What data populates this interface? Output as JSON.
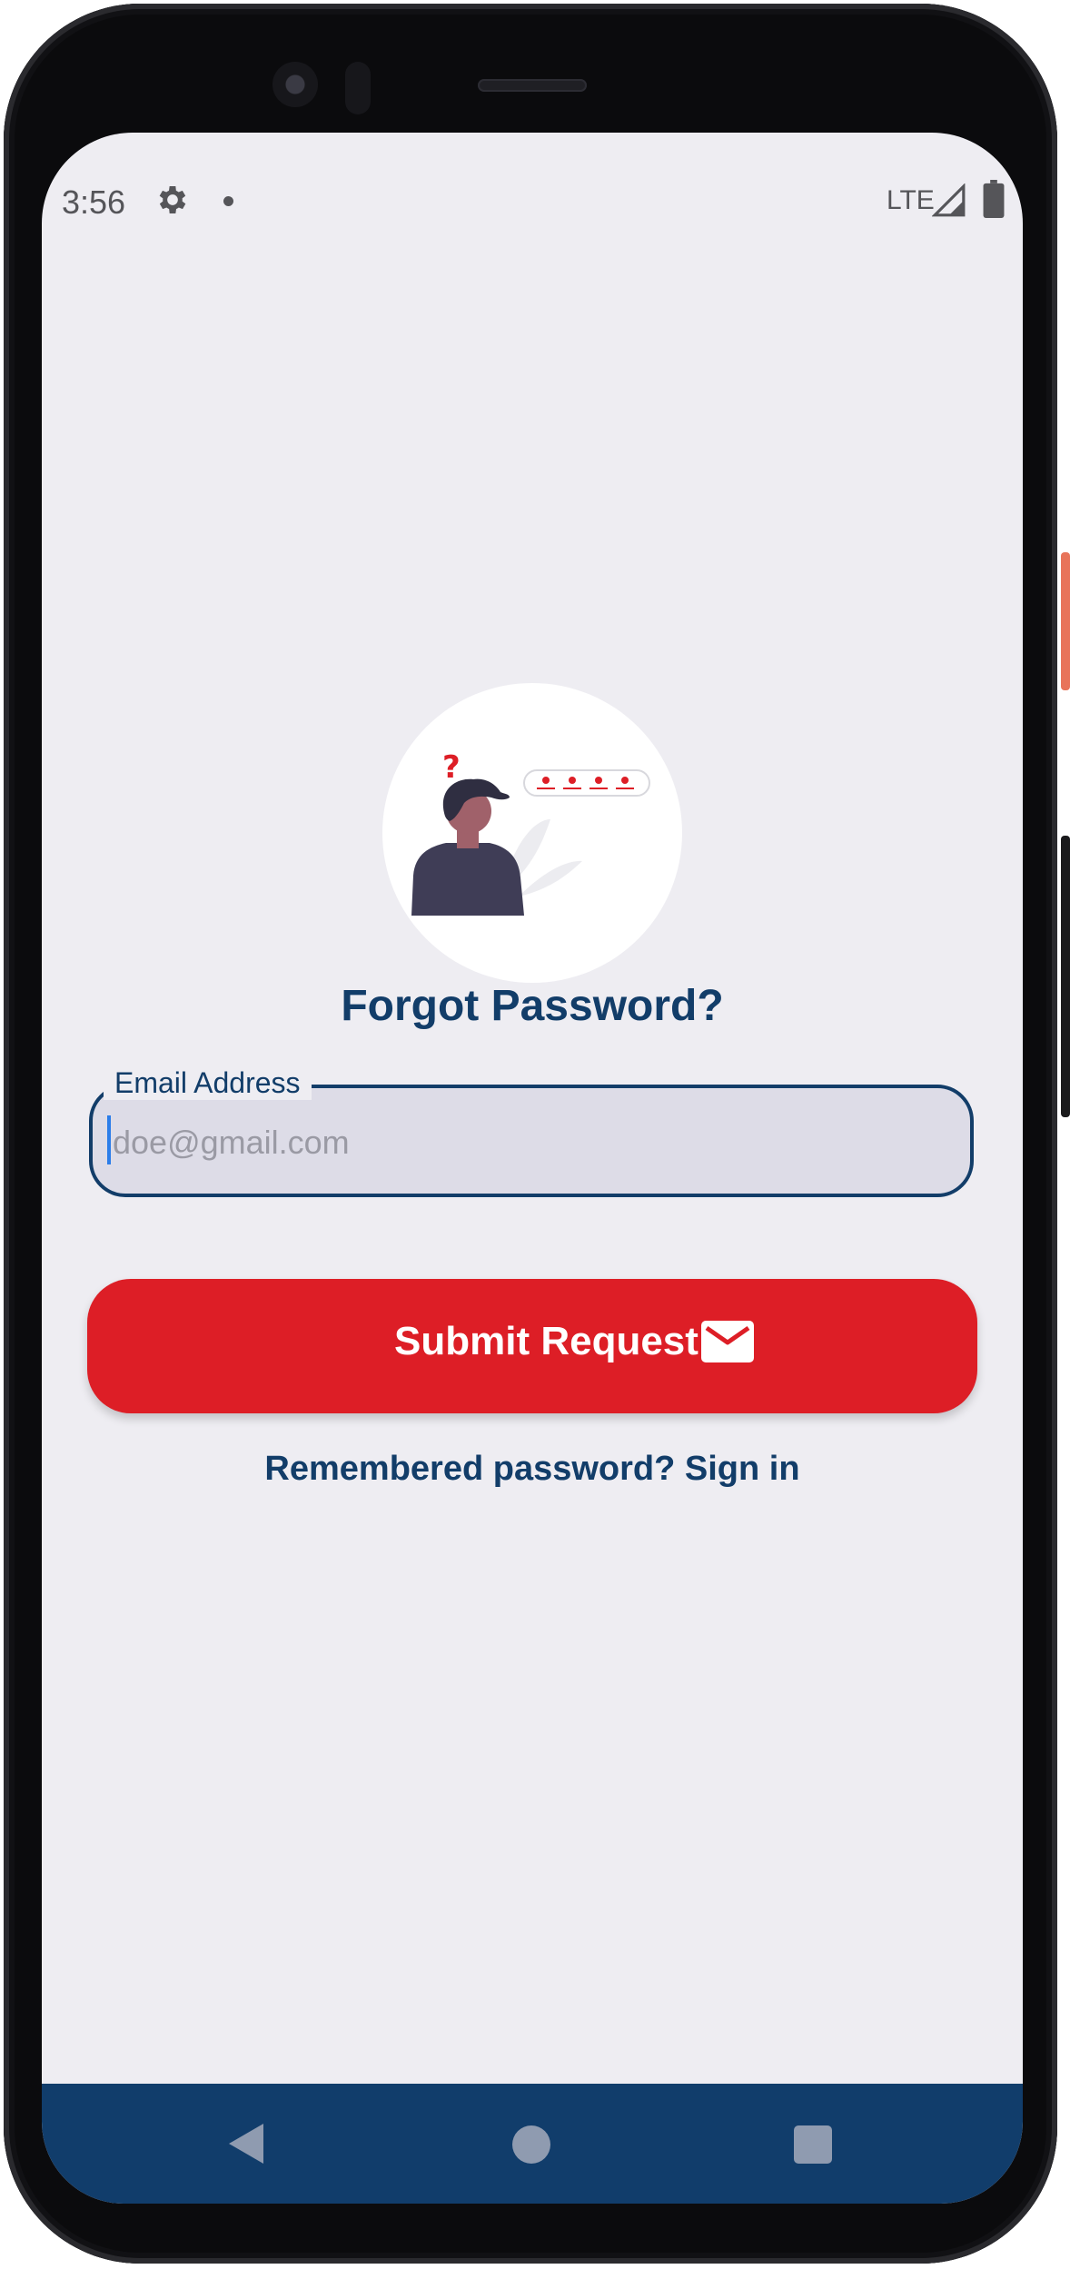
{
  "status_bar": {
    "time": "3:56",
    "network": "LTE",
    "icons": [
      "gear-icon",
      "notification-dot-icon",
      "signal-icon",
      "battery-icon"
    ]
  },
  "illustration": {
    "icon": "forgot-password-person-illustration"
  },
  "title": "Forgot Password?",
  "email_field": {
    "label": "Email Address",
    "placeholder": "doe@gmail.com",
    "value": ""
  },
  "submit_button": {
    "label": "Submit Request",
    "icon": "mail-icon"
  },
  "signin_link": "Remembered password? Sign in",
  "nav_bar": {
    "icons": [
      "back-icon",
      "home-icon",
      "recents-icon"
    ]
  },
  "colors": {
    "primary": "#123d69",
    "accent": "#dd1e26",
    "background": "#eeedf2",
    "field_fill": "#dddce7"
  }
}
